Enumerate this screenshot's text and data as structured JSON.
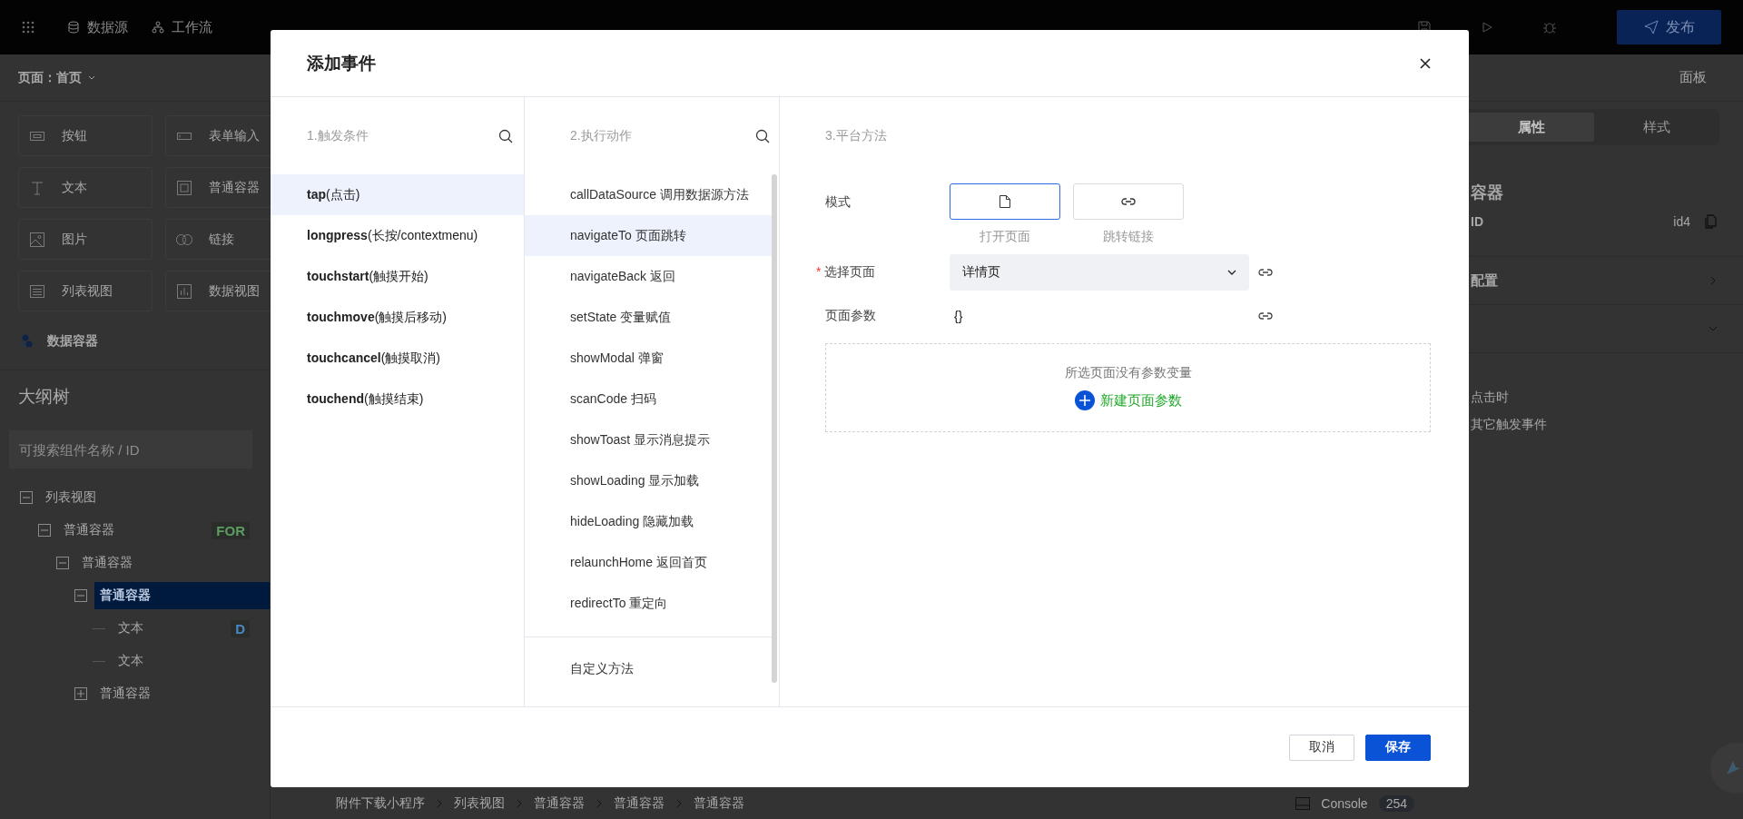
{
  "top_bar": {
    "nav": [
      {
        "kind": "database",
        "label": "数据源"
      },
      {
        "kind": "flow",
        "label": "工作流"
      }
    ],
    "publish_button": "发布"
  },
  "page_bar": {
    "page_selector": "页面：首页",
    "panel_label": "面板"
  },
  "components": [
    {
      "kind": "button",
      "label": "按钮"
    },
    {
      "kind": "input",
      "label": "表单输入"
    },
    {
      "kind": "text",
      "label": "文本"
    },
    {
      "kind": "container",
      "label": "普通容器"
    },
    {
      "kind": "image",
      "label": "图片"
    },
    {
      "kind": "link",
      "label": "链接"
    },
    {
      "kind": "list",
      "label": "列表视图"
    },
    {
      "kind": "chart",
      "label": "数据视图"
    }
  ],
  "data_container": "数据容器",
  "outline": {
    "title": "大纲树",
    "search_placeholder": "可搜索组件名称 / ID",
    "tree": [
      {
        "label": "列表视图",
        "expanded": true,
        "selected": false,
        "children": [
          {
            "label": "普通容器",
            "expanded": true,
            "selected": false,
            "badge": {
              "text": "FOR",
              "color": "#5c9c60"
            },
            "children": [
              {
                "label": "普通容器",
                "expanded": true,
                "selected": false,
                "children": [
                  {
                    "label": "普通容器",
                    "expanded": true,
                    "selected": true,
                    "children": [
                      {
                        "label": "文本",
                        "selected": false,
                        "badge": {
                          "text": "D",
                          "color": "#4a88c4"
                        }
                      },
                      {
                        "label": "文本",
                        "selected": false
                      }
                    ]
                  },
                  {
                    "label": "普通容器",
                    "expanded": false,
                    "selected": false
                  }
                ]
              }
            ]
          }
        ]
      }
    ]
  },
  "right_panel": {
    "tabs": [
      {
        "label": "属性",
        "selected": true
      },
      {
        "label": "样式",
        "selected": false
      }
    ],
    "component_name": "容器",
    "id_label": "ID",
    "id_value": "id4",
    "sections": [
      {
        "label": "配置",
        "expanded": false
      },
      {
        "expanded": true
      }
    ],
    "events": [
      "点击时",
      "其它触发事件"
    ]
  },
  "bottom_bar": {
    "breadcrumb": [
      "附件下载小程序",
      "列表视图",
      "普通容器",
      "普通容器",
      "普通容器"
    ],
    "console_label": "Console",
    "console_count": "254"
  },
  "modal": {
    "title": "添加事件",
    "triggers": {
      "header": "1.触发条件",
      "items": [
        {
          "label": "**tap**(点击)",
          "selected": true
        },
        {
          "label": "**longpress**(长按/contextmenu)",
          "selected": false
        },
        {
          "label": "**touchstart**(触摸开始)",
          "selected": false
        },
        {
          "label": "**touchmove**(触摸后移动)",
          "selected": false
        },
        {
          "label": "**touchcancel**(触摸取消)",
          "selected": false
        },
        {
          "label": "**touchend**(触摸结束)",
          "selected": false
        }
      ]
    },
    "actions": {
      "header": "2.执行动作",
      "items": [
        {
          "label": "callDataSource 调用数据源方法",
          "selected": false
        },
        {
          "label": "navigateTo 页面跳转",
          "selected": true
        },
        {
          "label": "navigateBack 返回",
          "selected": false
        },
        {
          "label": "setState 变量赋值",
          "selected": false
        },
        {
          "label": "showModal 弹窗",
          "selected": false
        },
        {
          "label": "scanCode 扫码",
          "selected": false
        },
        {
          "label": "showToast 显示消息提示",
          "selected": false
        },
        {
          "label": "showLoading 显示加载",
          "selected": false
        },
        {
          "label": "hideLoading 隐藏加载",
          "selected": false
        },
        {
          "label": "relaunchHome 返回首页",
          "selected": false
        },
        {
          "label": "redirectTo 重定向",
          "selected": false
        }
      ],
      "custom": {
        "label": "自定义方法",
        "selected": false
      }
    },
    "platform": {
      "header": "3.平台方法",
      "mode_label": "模式",
      "modes": [
        {
          "kind": "page",
          "label": "打开页面",
          "selected": true
        },
        {
          "kind": "link",
          "label": "跳转链接",
          "selected": false
        }
      ],
      "page_label": "选择页面",
      "required_mark": "*",
      "page_value": "详情页",
      "params_label": "页面参数",
      "params_value": "{}",
      "empty_text": "所选页面没有参数变量",
      "add_param": "新建页面参数"
    },
    "buttons": {
      "cancel": "取消",
      "save": "保存"
    }
  }
}
